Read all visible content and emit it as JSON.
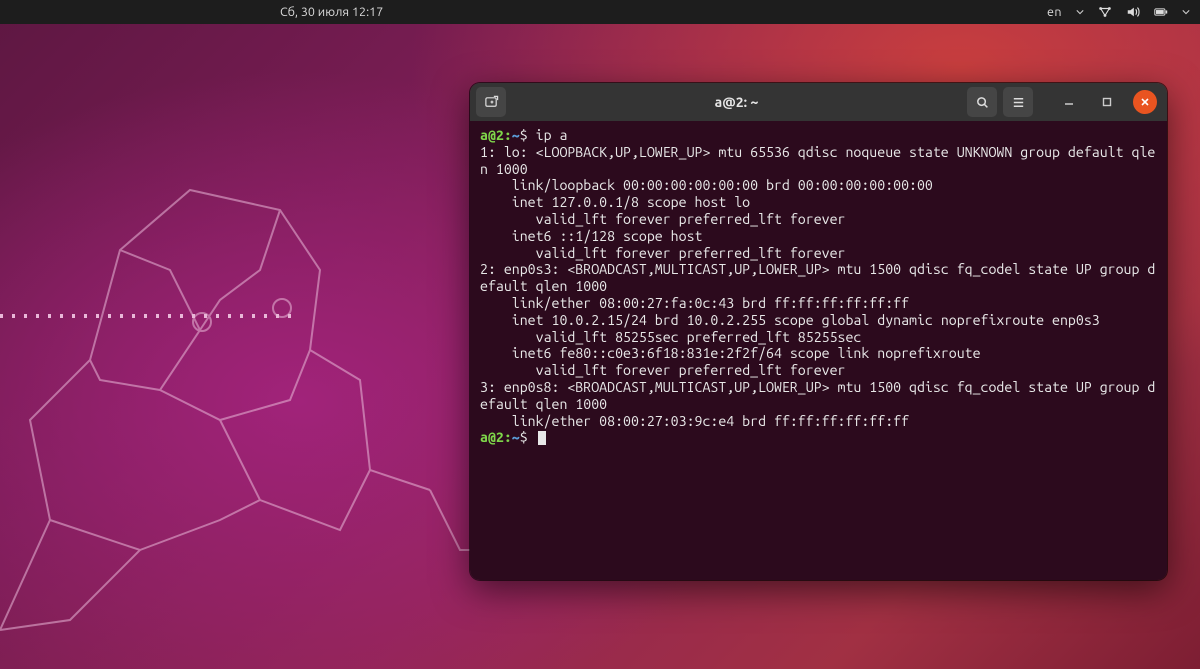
{
  "topbar": {
    "date": "Сб, 30 июля  12:17",
    "language": "en"
  },
  "terminal": {
    "window_title": "a@2: ~",
    "prompt_user": "a@2",
    "prompt_path": "~",
    "prompt_sep": ":",
    "prompt_symbol": "$",
    "command": "ip a",
    "output": "1: lo: <LOOPBACK,UP,LOWER_UP> mtu 65536 qdisc noqueue state UNKNOWN group default qlen 1000\n    link/loopback 00:00:00:00:00:00 brd 00:00:00:00:00:00\n    inet 127.0.0.1/8 scope host lo\n       valid_lft forever preferred_lft forever\n    inet6 ::1/128 scope host \n       valid_lft forever preferred_lft forever\n2: enp0s3: <BROADCAST,MULTICAST,UP,LOWER_UP> mtu 1500 qdisc fq_codel state UP group default qlen 1000\n    link/ether 08:00:27:fa:0c:43 brd ff:ff:ff:ff:ff:ff\n    inet 10.0.2.15/24 brd 10.0.2.255 scope global dynamic noprefixroute enp0s3\n       valid_lft 85255sec preferred_lft 85255sec\n    inet6 fe80::c0e3:6f18:831e:2f2f/64 scope link noprefixroute \n       valid_lft forever preferred_lft forever\n3: enp0s8: <BROADCAST,MULTICAST,UP,LOWER_UP> mtu 1500 qdisc fq_codel state UP group default qlen 1000\n    link/ether 08:00:27:03:9c:e4 brd ff:ff:ff:ff:ff:ff"
  }
}
